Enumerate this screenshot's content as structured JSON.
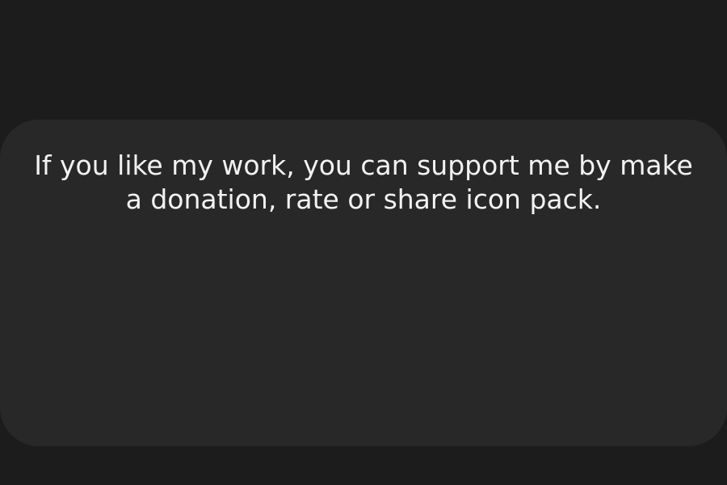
{
  "support_card": {
    "message": "If you like my work, you can support me by make a donation, rate or share icon pack."
  },
  "colors": {
    "background": "#1c1c1c",
    "card": "#282828",
    "text": "#f2f2f2"
  }
}
